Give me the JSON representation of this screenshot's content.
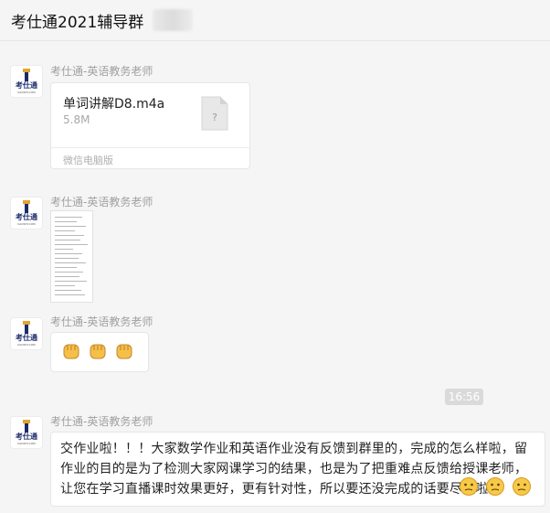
{
  "header": {
    "title": "考仕通2021辅导群"
  },
  "avatar": {
    "logo_text": "考仕通",
    "logo_sub": "KAOSHI.COM"
  },
  "messages": [
    {
      "sender": "考仕通-英语教务老师",
      "type": "file",
      "file_name": "单词讲解D8.m4a",
      "file_size": "5.8M",
      "file_icon": "unknown-file-icon",
      "source": "微信电脑版"
    },
    {
      "sender": "考仕通-英语教务老师",
      "type": "image"
    },
    {
      "sender": "考仕通-英语教务老师",
      "type": "emoji",
      "emojis": [
        "fist-icon",
        "fist-icon",
        "fist-icon"
      ]
    },
    {
      "sender": "考仕通-英语教务老师",
      "type": "text",
      "text": "交作业啦！！！大家数学作业和英语作业没有反馈到群里的，完成的怎么样啦，留作业的目的是为了检测大家网课学习的结果，也是为了把重难点反馈给授课老师，让您在学习直播课时效果更好，更有针对性，所以要还没完成的话要尽快啦",
      "trailing_emojis": [
        "thinking-face-icon",
        "thinking-face-icon",
        "thinking-face-icon"
      ]
    }
  ],
  "timestamp": "16:56",
  "colors": {
    "accent_logo": "#1b2a6b",
    "logo_gold": "#e0a630",
    "background": "#f5f5f5"
  }
}
